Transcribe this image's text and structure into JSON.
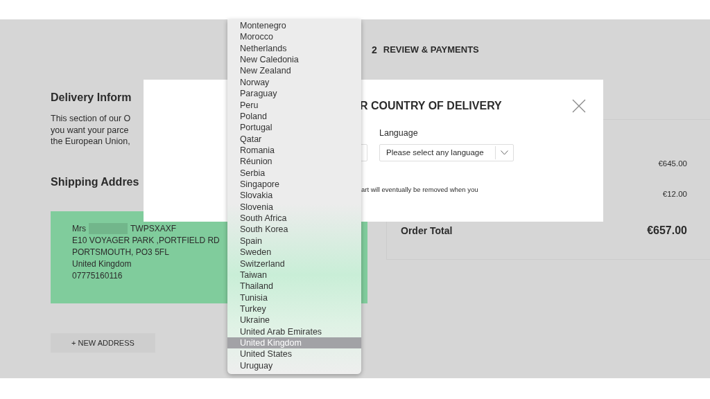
{
  "header": {
    "step_number": "2",
    "step_label": "REVIEW & PAYMENTS"
  },
  "delivery_info": {
    "title": "Delivery Inform",
    "lines": [
      "This section of our O",
      "you want your parce",
      "the European Union,"
    ]
  },
  "shipping": {
    "title": "Shipping Addres",
    "address": {
      "salutation": "Mrs",
      "surname": "TWPSXAXF",
      "lines": [
        "E10 VOYAGER PARK ,PORTFIELD RD",
        "PORTSMOUTH, PO3 5FL",
        "United Kingdom",
        "07775160116"
      ]
    },
    "new_address_button": "+ NEW ADDRESS"
  },
  "summary": {
    "rows": [
      {
        "amount": "€645.00"
      },
      {
        "amount": "€12.00"
      }
    ],
    "total": {
      "label": "Order Total",
      "amount": "€657.00"
    }
  },
  "modal": {
    "title": "R COUNTRY OF DELIVERY",
    "language_label": "Language",
    "language_select": "Please select any language",
    "note": "art will eventually be removed when you"
  },
  "country_dropdown": {
    "options": [
      {
        "label": "Montenegro",
        "selected": false
      },
      {
        "label": "Morocco",
        "selected": false
      },
      {
        "label": "Netherlands",
        "selected": false
      },
      {
        "label": "New Caledonia",
        "selected": false
      },
      {
        "label": "New Zealand",
        "selected": false
      },
      {
        "label": "Norway",
        "selected": false
      },
      {
        "label": "Paraguay",
        "selected": false
      },
      {
        "label": "Peru",
        "selected": false
      },
      {
        "label": "Poland",
        "selected": false
      },
      {
        "label": "Portugal",
        "selected": false
      },
      {
        "label": "Qatar",
        "selected": false
      },
      {
        "label": "Romania",
        "selected": false
      },
      {
        "label": "Réunion",
        "selected": false
      },
      {
        "label": "Serbia",
        "selected": false
      },
      {
        "label": "Singapore",
        "selected": false
      },
      {
        "label": "Slovakia",
        "selected": false
      },
      {
        "label": "Slovenia",
        "selected": false
      },
      {
        "label": "South Africa",
        "selected": false
      },
      {
        "label": "South Korea",
        "selected": false
      },
      {
        "label": "Spain",
        "selected": false
      },
      {
        "label": "Sweden",
        "selected": false
      },
      {
        "label": "Switzerland",
        "selected": false
      },
      {
        "label": "Taiwan",
        "selected": false
      },
      {
        "label": "Thailand",
        "selected": false
      },
      {
        "label": "Tunisia",
        "selected": false
      },
      {
        "label": "Turkey",
        "selected": false
      },
      {
        "label": "Ukraine",
        "selected": false
      },
      {
        "label": "United Arab Emirates",
        "selected": false
      },
      {
        "label": "United Kingdom",
        "selected": true
      },
      {
        "label": "United States",
        "selected": false
      },
      {
        "label": "Uruguay",
        "selected": false
      }
    ]
  }
}
